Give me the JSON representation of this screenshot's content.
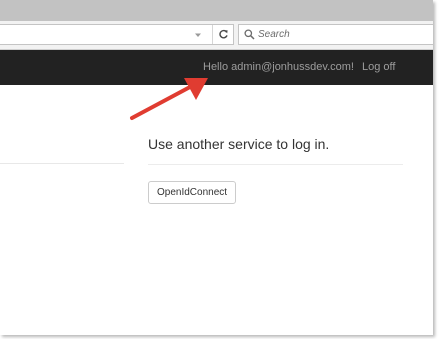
{
  "browser": {
    "search": {
      "placeholder": "Search"
    }
  },
  "navbar": {
    "greeting": "Hello admin@jonhussdev.com!",
    "logoff_label": "Log off"
  },
  "main": {
    "external_login": {
      "heading": "Use another service to log in.",
      "providers": [
        {
          "label": "OpenIdConnect"
        }
      ]
    }
  },
  "colors": {
    "navbar_bg": "#222222",
    "nav_link": "#9d9d9d",
    "annotation_arrow": "#e03c31"
  },
  "icons": {
    "url_dropdown": "chevron-down-icon",
    "reload": "reload-icon",
    "search": "search-icon",
    "annotation": "arrow-icon"
  }
}
